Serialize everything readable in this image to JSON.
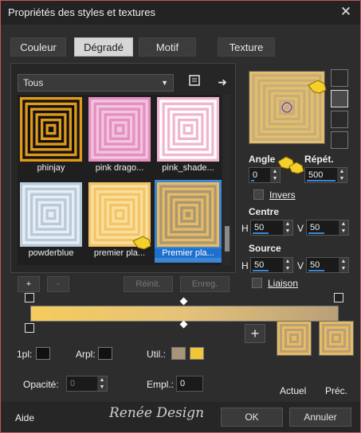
{
  "window": {
    "title": "Propriétés des styles et textures",
    "close": "✕"
  },
  "tabs": [
    {
      "label": "Couleur"
    },
    {
      "label": "Dégradé"
    },
    {
      "label": "Motif"
    },
    {
      "label": "Texture"
    }
  ],
  "category": {
    "value": "Tous"
  },
  "thumbnails": [
    {
      "caption": "phinjay",
      "c1": "#e09a1a",
      "c2": "#111111"
    },
    {
      "caption": "pink drago...",
      "c1": "#e48fc0",
      "c2": "#f2c4de"
    },
    {
      "caption": "pink_shade...",
      "c1": "#f0b6cf",
      "c2": "#ffffff"
    },
    {
      "caption": "powderblue",
      "c1": "#b8cad8",
      "c2": "#e7eef4"
    },
    {
      "caption": "premier pla...",
      "c1": "#f2c466",
      "c2": "#f9df9e"
    },
    {
      "caption": "Premier pla...",
      "c1": "#e6bb62",
      "c2": "#a89678"
    }
  ],
  "list_buttons": {
    "add": "+",
    "remove": "-",
    "reset": "Réinit.",
    "save": "Enreg."
  },
  "angle": {
    "label": "Angle",
    "value": "0"
  },
  "repeats": {
    "label": "Répét.",
    "value": "500"
  },
  "invert": {
    "label": "Invers"
  },
  "center": {
    "label": "Centre",
    "h_label": "H",
    "h": "50",
    "v_label": "V",
    "v": "50"
  },
  "source": {
    "label": "Source",
    "h_label": "H",
    "h": "50",
    "v_label": "V",
    "v": "50"
  },
  "link": {
    "label": "Liaison"
  },
  "stops": {
    "first_label": "1pl:",
    "arpl_label": "Arpl:",
    "util_label": "Util.:",
    "opacity_label": "Opacité:",
    "opacity_value": "0",
    "empl_label": "Empl.:",
    "empl_value": "0",
    "swatch1": "#a99478",
    "swatch2": "#f0c53a"
  },
  "current_label": "Actuel",
  "previous_label": "Préc.",
  "footer": {
    "help": "Aide",
    "watermark": "Renée Design",
    "ok": "OK",
    "cancel": "Annuler"
  },
  "colors": {
    "accent": "#3b86d6",
    "gradient_start": "#f5cc5c",
    "gradient_end": "#b8a078"
  }
}
